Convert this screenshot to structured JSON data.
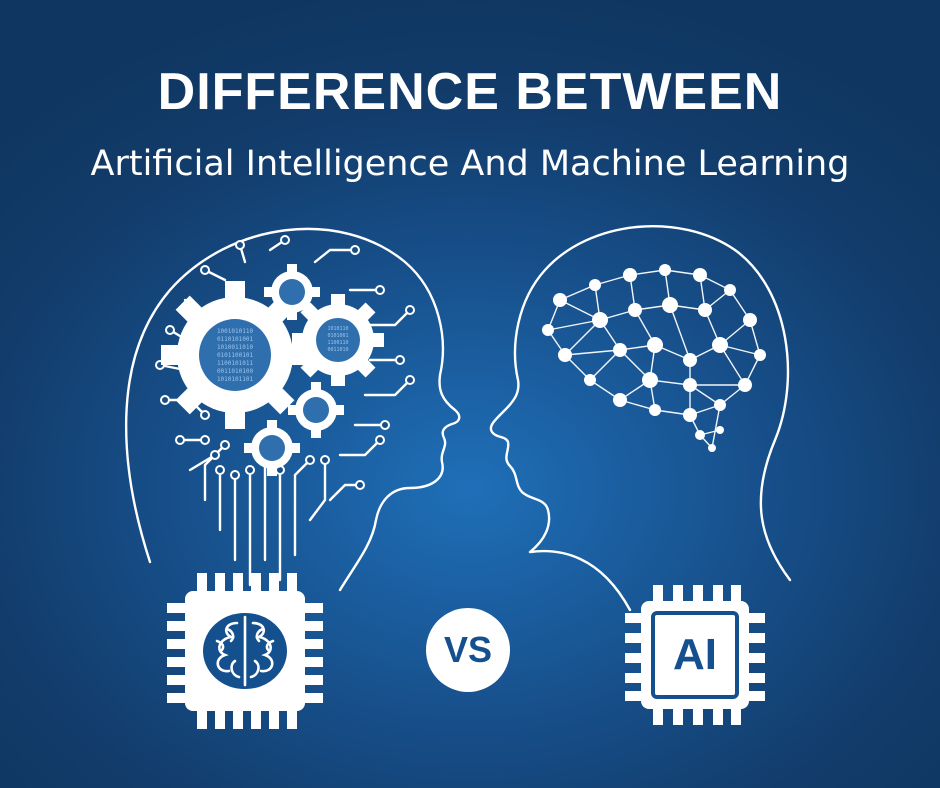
{
  "header": {
    "title": "DIFFERENCE BETWEEN",
    "subtitle": "Artificial Intelligence And Machine Learning"
  },
  "badges": {
    "vs_label": "VS",
    "ai_chip_label": "AI"
  },
  "colors": {
    "background": "#174f8a",
    "foreground": "#ffffff",
    "accent_text": "#15508e"
  },
  "icons": [
    "gear-head-icon",
    "neural-network-head-icon",
    "brain-chip-icon",
    "ai-chip-icon"
  ]
}
